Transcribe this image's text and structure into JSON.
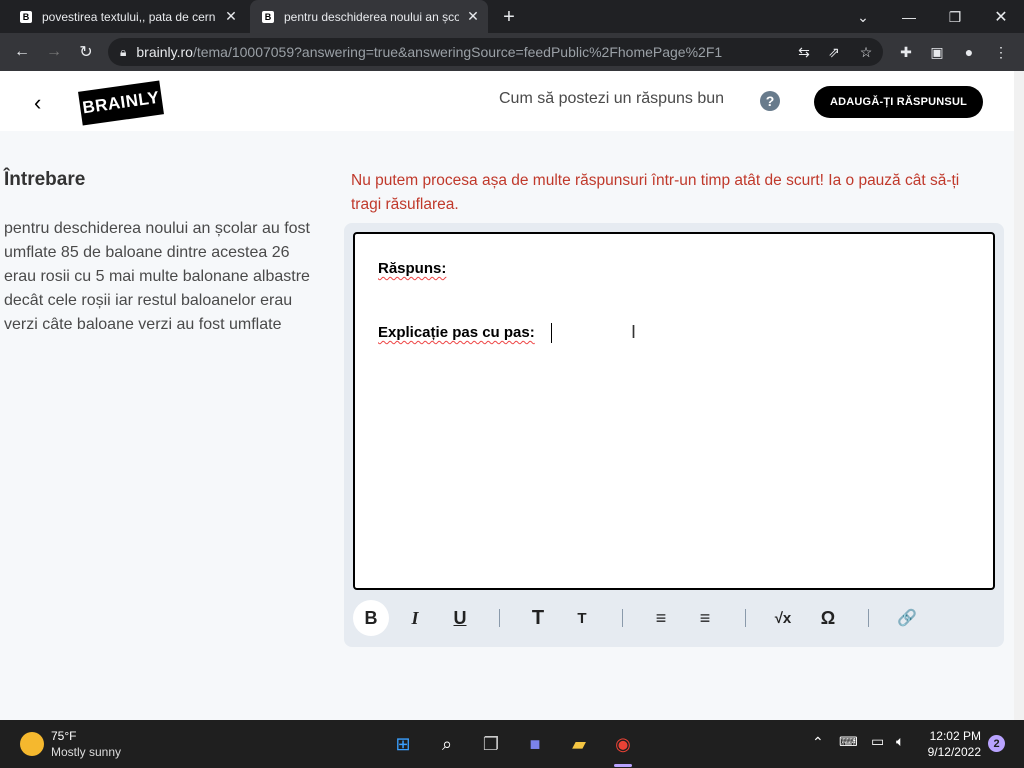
{
  "browser": {
    "tabs": [
      {
        "title": "povestirea textului,, pata de cern"
      },
      {
        "title": "pentru deschiderea noului an șco"
      }
    ],
    "url_host": "brainly.ro",
    "url_path": "/tema/10007059?answering=true&answeringSource=feedPublic%2FhomePage%2F1"
  },
  "header": {
    "logo": "BRAINLY",
    "howto": "Cum să postezi un răspuns bun",
    "help_icon": "?",
    "add_answer": "ADAUGĂ-ȚI RĂSPUNSUL"
  },
  "question": {
    "heading": "Întrebare",
    "text": "pentru deschiderea noului an școlar au fost umflate 85 de baloane dintre acestea 26 erau rosii cu 5 mai multe balonane albastre decât cele roșii iar restul baloanelor erau verzi câte baloane verzi au fost umflate"
  },
  "warning": "Nu putem procesa așa de multe răspunsuri într-un timp atât de scurt! Ia o pauză cât să-ți tragi răsuflarea.",
  "editor": {
    "answer_label": "Răspuns:",
    "explanation_label": "Explicație pas cu pas:"
  },
  "toolbar": {
    "bold": "B",
    "italic": "I",
    "underline": "U",
    "heading_large": "T",
    "heading_small": "T",
    "numbered_list": "≡",
    "bullet_list": "≡",
    "sqrt": "√x",
    "omega": "Ω",
    "attach": "🔗"
  },
  "taskbar": {
    "temperature": "75°F",
    "weather": "Mostly sunny",
    "time": "12:02 PM",
    "date": "9/12/2022",
    "notifications": "2"
  }
}
